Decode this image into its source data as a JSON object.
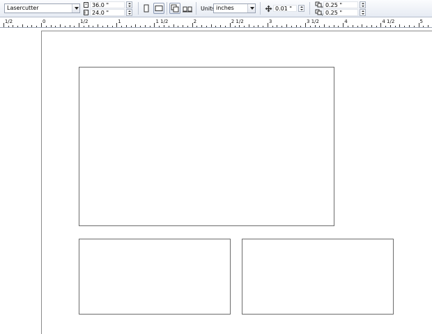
{
  "toolbar": {
    "preset": {
      "value": "Lasercutter"
    },
    "page_width": {
      "value": "36.0 \""
    },
    "page_height": {
      "value": "24.0 \""
    },
    "units": {
      "label": "Units:",
      "value": "inches"
    },
    "nudge": {
      "value": "0.01 \""
    },
    "duplicate_x": {
      "value": "0.25 \""
    },
    "duplicate_y": {
      "value": "0.25 \""
    }
  },
  "ruler": {
    "labels": [
      "1/2",
      "0",
      "1/2",
      "1",
      "1 1/2",
      "2",
      "2 1/2",
      "3",
      "3 1/2",
      "4",
      "4 1/2",
      "5"
    ]
  },
  "colors": {
    "toolbar_top": "#fbfcfe",
    "toolbar_bottom": "#e6ebf3",
    "shape_outline": "#6b6b6b",
    "page_edge": "#8a8a8a"
  },
  "icons": {
    "page_width": "page-width-icon",
    "page_height": "page-height-icon",
    "portrait": "portrait-icon",
    "landscape": "landscape-icon",
    "all_pages": "all-pages-icon",
    "current_page": "current-page-icon",
    "nudge": "nudge-move-icon",
    "duplicate_x": "duplicate-x-icon",
    "duplicate_y": "duplicate-y-icon"
  }
}
